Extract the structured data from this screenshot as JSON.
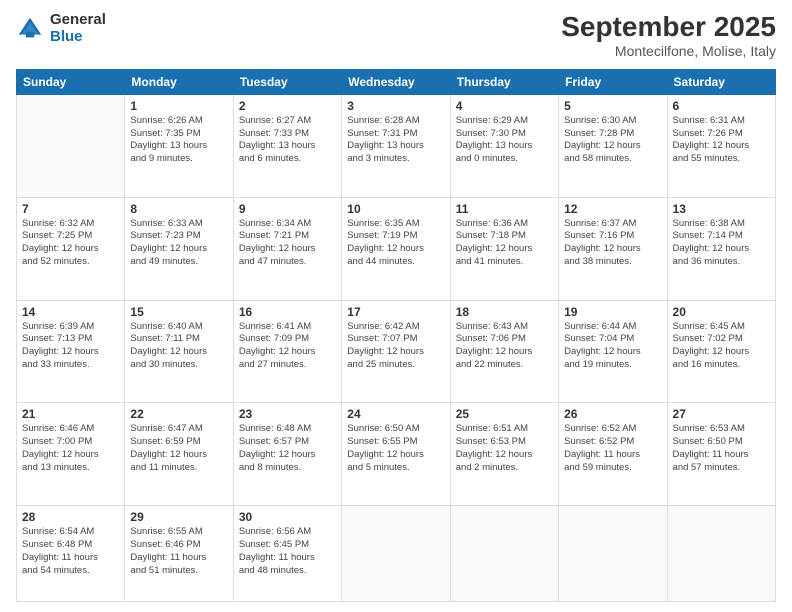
{
  "logo": {
    "general": "General",
    "blue": "Blue"
  },
  "title": {
    "month": "September 2025",
    "location": "Montecilfone, Molise, Italy"
  },
  "headers": [
    "Sunday",
    "Monday",
    "Tuesday",
    "Wednesday",
    "Thursday",
    "Friday",
    "Saturday"
  ],
  "weeks": [
    [
      {
        "day": "",
        "info": ""
      },
      {
        "day": "1",
        "info": "Sunrise: 6:26 AM\nSunset: 7:35 PM\nDaylight: 13 hours\nand 9 minutes."
      },
      {
        "day": "2",
        "info": "Sunrise: 6:27 AM\nSunset: 7:33 PM\nDaylight: 13 hours\nand 6 minutes."
      },
      {
        "day": "3",
        "info": "Sunrise: 6:28 AM\nSunset: 7:31 PM\nDaylight: 13 hours\nand 3 minutes."
      },
      {
        "day": "4",
        "info": "Sunrise: 6:29 AM\nSunset: 7:30 PM\nDaylight: 13 hours\nand 0 minutes."
      },
      {
        "day": "5",
        "info": "Sunrise: 6:30 AM\nSunset: 7:28 PM\nDaylight: 12 hours\nand 58 minutes."
      },
      {
        "day": "6",
        "info": "Sunrise: 6:31 AM\nSunset: 7:26 PM\nDaylight: 12 hours\nand 55 minutes."
      }
    ],
    [
      {
        "day": "7",
        "info": "Sunrise: 6:32 AM\nSunset: 7:25 PM\nDaylight: 12 hours\nand 52 minutes."
      },
      {
        "day": "8",
        "info": "Sunrise: 6:33 AM\nSunset: 7:23 PM\nDaylight: 12 hours\nand 49 minutes."
      },
      {
        "day": "9",
        "info": "Sunrise: 6:34 AM\nSunset: 7:21 PM\nDaylight: 12 hours\nand 47 minutes."
      },
      {
        "day": "10",
        "info": "Sunrise: 6:35 AM\nSunset: 7:19 PM\nDaylight: 12 hours\nand 44 minutes."
      },
      {
        "day": "11",
        "info": "Sunrise: 6:36 AM\nSunset: 7:18 PM\nDaylight: 12 hours\nand 41 minutes."
      },
      {
        "day": "12",
        "info": "Sunrise: 6:37 AM\nSunset: 7:16 PM\nDaylight: 12 hours\nand 38 minutes."
      },
      {
        "day": "13",
        "info": "Sunrise: 6:38 AM\nSunset: 7:14 PM\nDaylight: 12 hours\nand 36 minutes."
      }
    ],
    [
      {
        "day": "14",
        "info": "Sunrise: 6:39 AM\nSunset: 7:13 PM\nDaylight: 12 hours\nand 33 minutes."
      },
      {
        "day": "15",
        "info": "Sunrise: 6:40 AM\nSunset: 7:11 PM\nDaylight: 12 hours\nand 30 minutes."
      },
      {
        "day": "16",
        "info": "Sunrise: 6:41 AM\nSunset: 7:09 PM\nDaylight: 12 hours\nand 27 minutes."
      },
      {
        "day": "17",
        "info": "Sunrise: 6:42 AM\nSunset: 7:07 PM\nDaylight: 12 hours\nand 25 minutes."
      },
      {
        "day": "18",
        "info": "Sunrise: 6:43 AM\nSunset: 7:06 PM\nDaylight: 12 hours\nand 22 minutes."
      },
      {
        "day": "19",
        "info": "Sunrise: 6:44 AM\nSunset: 7:04 PM\nDaylight: 12 hours\nand 19 minutes."
      },
      {
        "day": "20",
        "info": "Sunrise: 6:45 AM\nSunset: 7:02 PM\nDaylight: 12 hours\nand 16 minutes."
      }
    ],
    [
      {
        "day": "21",
        "info": "Sunrise: 6:46 AM\nSunset: 7:00 PM\nDaylight: 12 hours\nand 13 minutes."
      },
      {
        "day": "22",
        "info": "Sunrise: 6:47 AM\nSunset: 6:59 PM\nDaylight: 12 hours\nand 11 minutes."
      },
      {
        "day": "23",
        "info": "Sunrise: 6:48 AM\nSunset: 6:57 PM\nDaylight: 12 hours\nand 8 minutes."
      },
      {
        "day": "24",
        "info": "Sunrise: 6:50 AM\nSunset: 6:55 PM\nDaylight: 12 hours\nand 5 minutes."
      },
      {
        "day": "25",
        "info": "Sunrise: 6:51 AM\nSunset: 6:53 PM\nDaylight: 12 hours\nand 2 minutes."
      },
      {
        "day": "26",
        "info": "Sunrise: 6:52 AM\nSunset: 6:52 PM\nDaylight: 11 hours\nand 59 minutes."
      },
      {
        "day": "27",
        "info": "Sunrise: 6:53 AM\nSunset: 6:50 PM\nDaylight: 11 hours\nand 57 minutes."
      }
    ],
    [
      {
        "day": "28",
        "info": "Sunrise: 6:54 AM\nSunset: 6:48 PM\nDaylight: 11 hours\nand 54 minutes."
      },
      {
        "day": "29",
        "info": "Sunrise: 6:55 AM\nSunset: 6:46 PM\nDaylight: 11 hours\nand 51 minutes."
      },
      {
        "day": "30",
        "info": "Sunrise: 6:56 AM\nSunset: 6:45 PM\nDaylight: 11 hours\nand 48 minutes."
      },
      {
        "day": "",
        "info": ""
      },
      {
        "day": "",
        "info": ""
      },
      {
        "day": "",
        "info": ""
      },
      {
        "day": "",
        "info": ""
      }
    ]
  ]
}
